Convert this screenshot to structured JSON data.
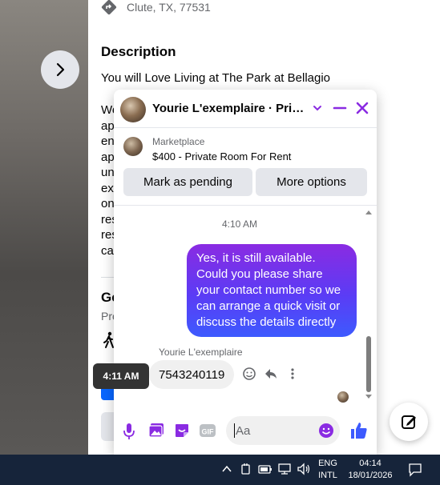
{
  "listing": {
    "location": "Clute, TX, 77531",
    "description_heading": "Description",
    "description_first_line": "You will Love Living at The Park at Bellagio",
    "description_body_fragments": [
      "We",
      "ap",
      "en",
      "ap",
      "un",
      "ex",
      "on",
      "res",
      "res",
      "cat"
    ],
    "general_heading_fragment": "Ge",
    "general_sub_fragment": "Pro"
  },
  "chat": {
    "title": "Yourie L'exemplaire · Priva...",
    "marketplace_label": "Marketplace",
    "marketplace_item": "$400 - Private Room For Rent",
    "mark_pending_label": "Mark as pending",
    "more_options_label": "More options",
    "timestamp": "4:10 AM",
    "outgoing_message": "Yes, it is still available. Could you please share your contact number so we can arrange a quick visit or discuss the details directly",
    "sender_name": "Yourie L'exemplaire",
    "incoming_message": "7543240119",
    "tooltip_time": "4:11 AM",
    "input_placeholder": "Aa",
    "accent_color": "#8a2be2"
  },
  "taskbar": {
    "lang_top": "ENG",
    "lang_bottom": "INTL",
    "time": "04:14",
    "date": "18/01/2026"
  }
}
